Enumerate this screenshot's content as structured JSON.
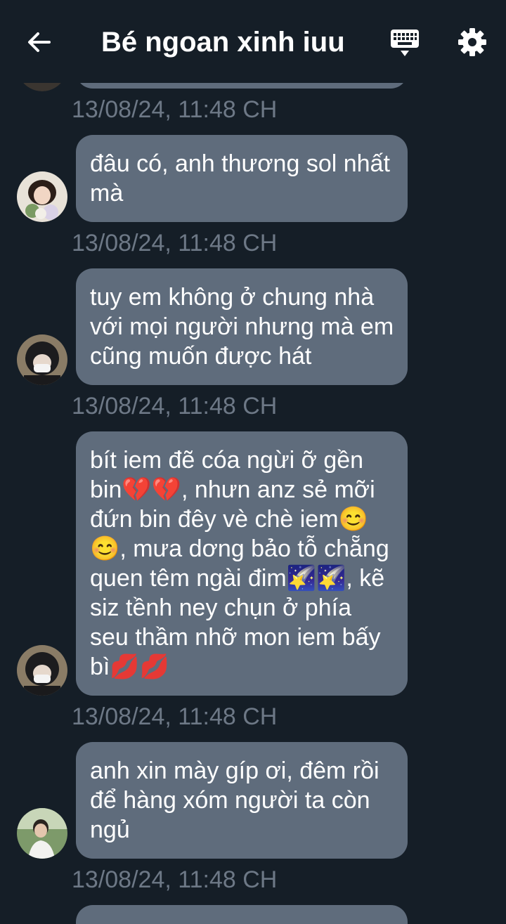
{
  "header": {
    "title": "Bé ngoan xinh iuu",
    "back_icon": "arrow-left-icon",
    "keyboard_icon": "keyboard-icon",
    "settings_icon": "gear-icon"
  },
  "messages": [
    {
      "text": "đâu có, anh thương sol nhất mà",
      "timestamp": "13/08/24, 11:48 CH"
    },
    {
      "text": "tuy em không ở chung nhà với mọi người nhưng mà em cũng muốn được hát",
      "timestamp": "13/08/24, 11:48 CH"
    },
    {
      "text": "bít iem đẽ cóa ngừi ỡ gền bin💔💔, nhưn anz sẻ mỡi đứn bin đêy vè chè iem😊😊, mưa dơng bảo tỗ chẵng quen têm ngài đim🌠🌠, kẽ siz tềnh ney chụn ở phía seu thầm nhỡ mon iem bấy bì💋💋",
      "timestamp": "13/08/24, 11:48 CH"
    },
    {
      "text": "anh xin mày gíp ơi, đêm rồi để hàng xóm người ta còn ngủ",
      "timestamp": "13/08/24, 11:48 CH"
    }
  ],
  "top_timestamp": "13/08/24, 11:48 CH",
  "colors": {
    "background": "#151e27",
    "bubble": "#5f6c7c",
    "timestamp": "#6d7886",
    "text": "#ffffff"
  }
}
